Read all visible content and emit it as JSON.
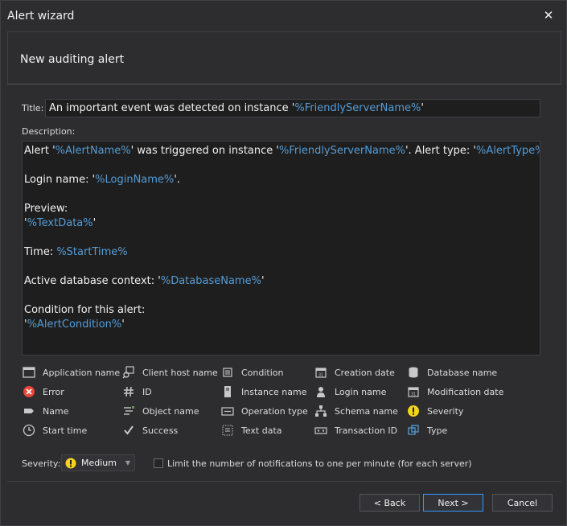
{
  "window": {
    "title": "Alert wizard",
    "close_glyph": "✕"
  },
  "header": {
    "title": "New auditing alert"
  },
  "form": {
    "title_label": "Title:",
    "title_value": {
      "prefix": "An important event was detected on instance '",
      "var": "%FriendlyServerName%",
      "suffix": "'"
    },
    "description_label": "Description:",
    "description_lines": [
      [
        [
          "t",
          "Alert '"
        ],
        [
          "v",
          "%AlertName%"
        ],
        [
          "t",
          "' was triggered on instance '"
        ],
        [
          "v",
          "%FriendlyServerName%"
        ],
        [
          "t",
          "'. Alert type: '"
        ],
        [
          "v",
          "%AlertType%"
        ],
        [
          "t",
          "'"
        ]
      ],
      [],
      [
        [
          "t",
          "Login name: '"
        ],
        [
          "v",
          "%LoginName%"
        ],
        [
          "t",
          "'."
        ]
      ],
      [],
      [
        [
          "t",
          "Preview:"
        ]
      ],
      [
        [
          "t",
          "'"
        ],
        [
          "v",
          "%TextData%"
        ],
        [
          "t",
          "'"
        ]
      ],
      [],
      [
        [
          "t",
          "Time: "
        ],
        [
          "v",
          "%StartTime%"
        ]
      ],
      [],
      [
        [
          "t",
          "Active database context: '"
        ],
        [
          "v",
          "%DatabaseName%"
        ],
        [
          "t",
          "'"
        ]
      ],
      [],
      [
        [
          "t",
          "Condition for this alert:"
        ]
      ],
      [
        [
          "t",
          "'"
        ],
        [
          "v",
          "%AlertCondition%"
        ],
        [
          "t",
          "'"
        ]
      ]
    ]
  },
  "tags": [
    {
      "label": "Application name",
      "icon": "window-icon"
    },
    {
      "label": "Client host name",
      "icon": "client-host-icon"
    },
    {
      "label": "Condition",
      "icon": "condition-icon"
    },
    {
      "label": "Creation date",
      "icon": "calendar-icon"
    },
    {
      "label": "Database name",
      "icon": "database-icon"
    },
    {
      "label": "Error",
      "icon": "error-icon",
      "color": "#e8453c"
    },
    {
      "label": "ID",
      "icon": "hash-icon"
    },
    {
      "label": "Instance name",
      "icon": "server-icon"
    },
    {
      "label": "Login name",
      "icon": "user-icon"
    },
    {
      "label": "Modification date",
      "icon": "calendar-edit-icon"
    },
    {
      "label": "Name",
      "icon": "tag-icon"
    },
    {
      "label": "Object name",
      "icon": "object-icon"
    },
    {
      "label": "Operation type",
      "icon": "operation-icon"
    },
    {
      "label": "Schema name",
      "icon": "schema-icon"
    },
    {
      "label": "Severity",
      "icon": "warning-icon",
      "color": "#f5d41c"
    },
    {
      "label": "Start time",
      "icon": "clock-icon"
    },
    {
      "label": "Success",
      "icon": "checkmark-icon"
    },
    {
      "label": "Text data",
      "icon": "text-data-icon"
    },
    {
      "label": "Transaction ID",
      "icon": "transaction-icon"
    },
    {
      "label": "Type",
      "icon": "type-icon",
      "color": "#569cd6"
    }
  ],
  "severity": {
    "label": "Severity:",
    "value": "Medium",
    "icon": "warning-icon",
    "color": "#f5d41c"
  },
  "limit": {
    "label": "Limit the number of notifications to one per minute (for each server)",
    "checked": false
  },
  "buttons": {
    "back": "< Back",
    "next": "Next >",
    "cancel": "Cancel"
  },
  "colors": {
    "background": "#2d2d30",
    "field": "#1e1e1e",
    "variable": "#569cd6",
    "accent": "#3399ff"
  }
}
